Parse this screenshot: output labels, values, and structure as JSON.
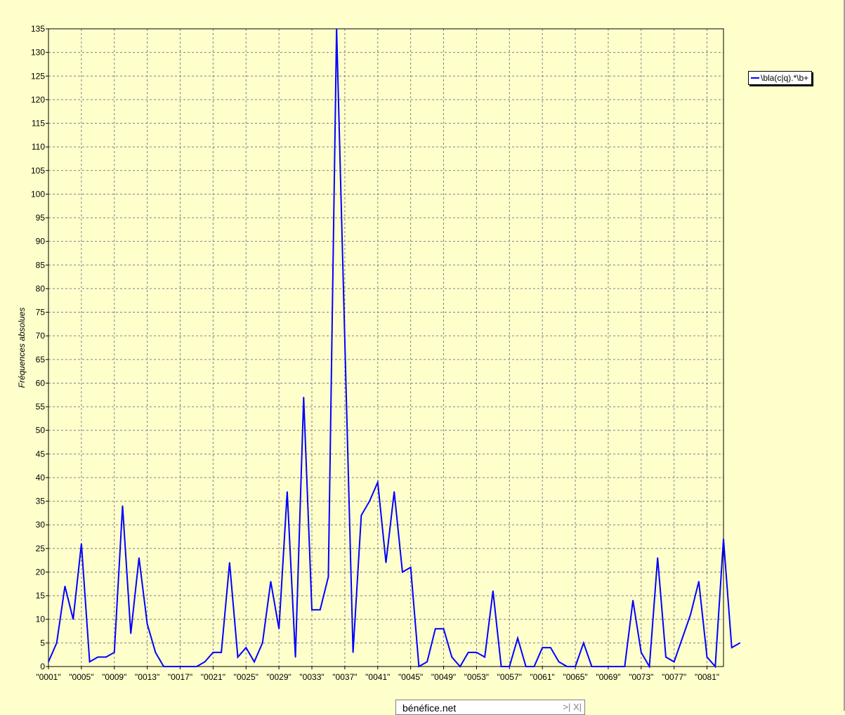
{
  "chart_data": {
    "type": "line",
    "title": "",
    "xlabel": "",
    "ylabel": "Fréquences absolues",
    "ylim": [
      0,
      135
    ],
    "ytick_step": 5,
    "grid": true,
    "legend_placement": "right",
    "x_tick_every": 4,
    "categories": [
      "\"0001\"",
      "\"0002\"",
      "\"0003\"",
      "\"0004\"",
      "\"0005\"",
      "\"0006\"",
      "\"0007\"",
      "\"0008\"",
      "\"0009\"",
      "\"0010\"",
      "\"0011\"",
      "\"0012\"",
      "\"0013\"",
      "\"0014\"",
      "\"0015\"",
      "\"0016\"",
      "\"0017\"",
      "\"0018\"",
      "\"0019\"",
      "\"0020\"",
      "\"0021\"",
      "\"0022\"",
      "\"0023\"",
      "\"0024\"",
      "\"0025\"",
      "\"0026\"",
      "\"0027\"",
      "\"0028\"",
      "\"0029\"",
      "\"0030\"",
      "\"0031\"",
      "\"0032\"",
      "\"0033\"",
      "\"0034\"",
      "\"0035\"",
      "\"0036\"",
      "\"0037\"",
      "\"0038\"",
      "\"0039\"",
      "\"0040\"",
      "\"0041\"",
      "\"0042\"",
      "\"0043\"",
      "\"0044\"",
      "\"0045\"",
      "\"0046\"",
      "\"0047\"",
      "\"0048\"",
      "\"0049\"",
      "\"0050\"",
      "\"0051\"",
      "\"0052\"",
      "\"0053\"",
      "\"0054\"",
      "\"0055\"",
      "\"0056\"",
      "\"0057\"",
      "\"0058\"",
      "\"0059\"",
      "\"0060\"",
      "\"0061\"",
      "\"0062\"",
      "\"0063\"",
      "\"0064\"",
      "\"0065\"",
      "\"0066\"",
      "\"0067\"",
      "\"0068\"",
      "\"0069\"",
      "\"0070\"",
      "\"0071\"",
      "\"0072\"",
      "\"0073\"",
      "\"0074\"",
      "\"0075\"",
      "\"0076\"",
      "\"0077\"",
      "\"0078\"",
      "\"0079\"",
      "\"0080\"",
      "\"0081\"",
      "\"0082\"",
      "\"0083\""
    ],
    "series": [
      {
        "name": "\\bla(c|q).*\\b+",
        "color": "#0000ff",
        "values": [
          1,
          5,
          17,
          10,
          26,
          1,
          2,
          2,
          3,
          34,
          7,
          23,
          9,
          3,
          0,
          0,
          0,
          0,
          0,
          1,
          3,
          3,
          22,
          2,
          4,
          1,
          5,
          18,
          8,
          37,
          2,
          57,
          12,
          12,
          19,
          135,
          69,
          3,
          32,
          35,
          39,
          22,
          37,
          20,
          21,
          0,
          1,
          8,
          8,
          2,
          0,
          3,
          3,
          2,
          16,
          0,
          0,
          6,
          0,
          0,
          4,
          4,
          1,
          0,
          0,
          5,
          0,
          0,
          0,
          0,
          0,
          14,
          3,
          0,
          23,
          2,
          1,
          6,
          11,
          18,
          2,
          0,
          27,
          4,
          5
        ]
      }
    ]
  },
  "footer": {
    "text": "bénéfice.net",
    "nav": ">| X|"
  },
  "colors": {
    "background": "#ffffcc",
    "plot_background": "#ffffcc",
    "series": "#0000ff",
    "grid": "#808080"
  }
}
